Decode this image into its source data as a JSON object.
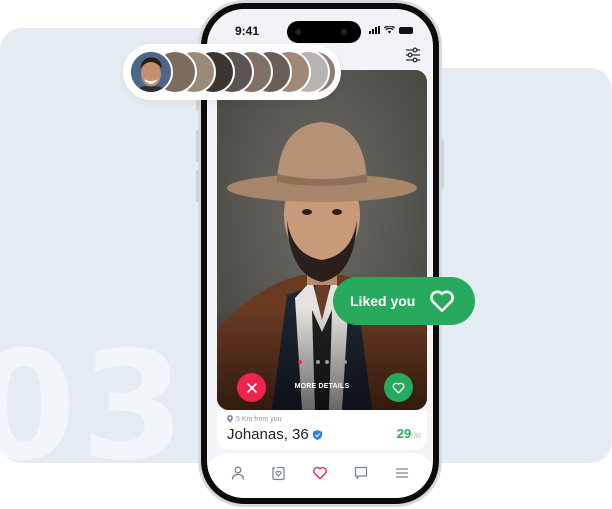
{
  "background": {
    "step_number": "03",
    "panel_color": "#e5ebf3"
  },
  "status_bar": {
    "time": "9:41"
  },
  "header": {
    "filter_icon": "sliders-icon"
  },
  "stories": {
    "count": 10,
    "avatars": [
      "story-1",
      "story-2",
      "story-3",
      "story-4",
      "story-5",
      "story-6",
      "story-7",
      "story-8",
      "story-9",
      "story-10"
    ]
  },
  "profile_card": {
    "photo_pages": 6,
    "active_photo": 0,
    "more_details": "MORE DETAILS",
    "distance": "5 Km from you",
    "name_age": "Johanas, 36",
    "verified": true,
    "match_score": "29",
    "match_total": "/36"
  },
  "liked_badge": {
    "label": "Liked you"
  },
  "tabbar": {
    "items": [
      {
        "name": "profile",
        "icon": "user-icon"
      },
      {
        "name": "rewind",
        "icon": "rewind-heart-icon"
      },
      {
        "name": "likes",
        "icon": "heart-icon",
        "active": true
      },
      {
        "name": "chat",
        "icon": "chat-icon"
      },
      {
        "name": "menu",
        "icon": "menu-icon"
      }
    ]
  },
  "colors": {
    "accent_red": "#ee2450",
    "accent_green": "#27a95e",
    "verified_blue": "#2f7ef3"
  }
}
